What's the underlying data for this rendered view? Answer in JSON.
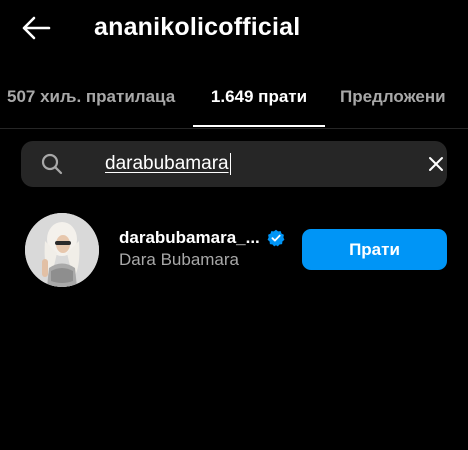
{
  "header": {
    "title": "ananikolicofficial",
    "back_icon": "arrow-left-icon"
  },
  "tabs": [
    {
      "label": "507 хиљ. пратилаца",
      "active": false
    },
    {
      "label": "1.649 прати",
      "active": true
    },
    {
      "label": "Предложени",
      "active": false
    }
  ],
  "search": {
    "value": "darabubamara",
    "search_icon": "search-icon",
    "clear_icon": "close-icon"
  },
  "results": [
    {
      "username": "darabubamara_...",
      "full_name": "Dara Bubamara",
      "verified": true,
      "button_label": "Прати"
    }
  ],
  "colors": {
    "background": "#000000",
    "search_bg": "#262626",
    "secondary_text": "#a8a8a8",
    "follow_button": "#0095f6",
    "verified_badge": "#0095f6"
  }
}
